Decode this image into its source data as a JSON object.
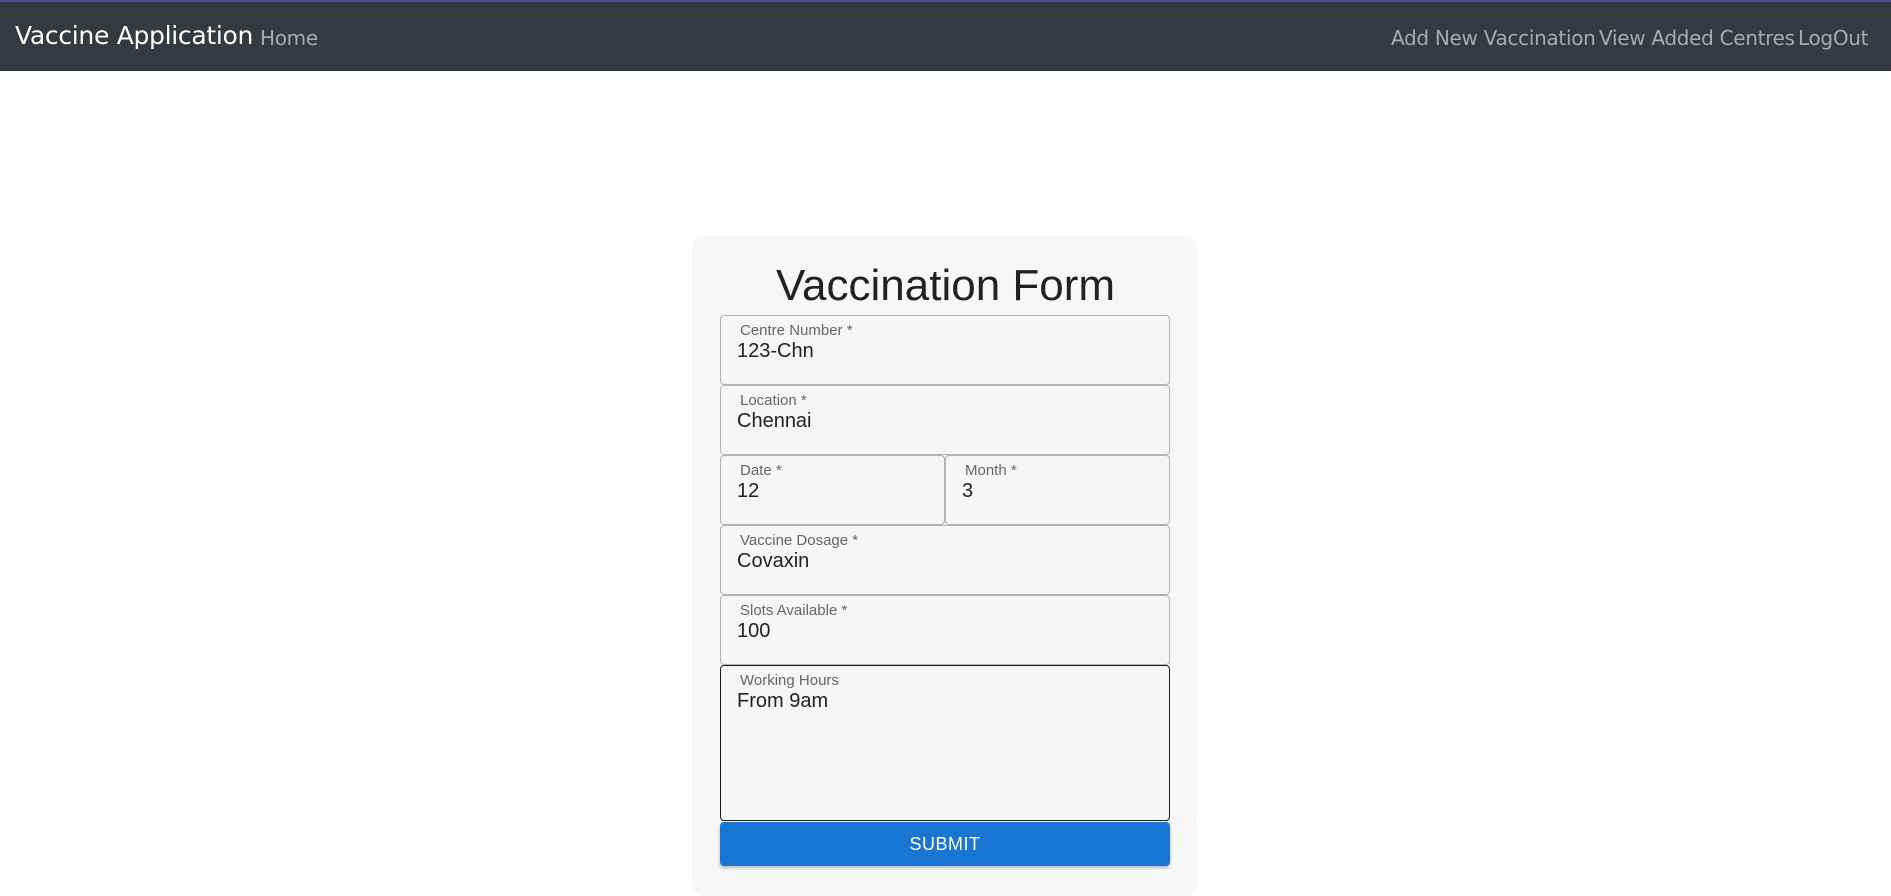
{
  "navbar": {
    "brand": "Vaccine Application",
    "home": "Home",
    "add_new": "Add New Vaccination",
    "view_centres": "View Added Centres",
    "logout": "LogOut"
  },
  "form": {
    "title": "Vaccination Form",
    "centre_number": {
      "label": "Centre Number *",
      "value": "123-Chn"
    },
    "location": {
      "label": "Location *",
      "value": "Chennai"
    },
    "date": {
      "label": "Date *",
      "value": "12"
    },
    "month": {
      "label": "Month *",
      "value": "3"
    },
    "dosage": {
      "label": "Vaccine Dosage *",
      "value": "Covaxin"
    },
    "slots": {
      "label": "Slots Available *",
      "value": "100"
    },
    "hours": {
      "label": "Working Hours",
      "value": "From 9am"
    },
    "submit_label": "SUBMIT"
  },
  "colors": {
    "navbar_bg": "#343a40",
    "submit_bg": "#1976d2",
    "card_bg": "#f7f7f7"
  }
}
